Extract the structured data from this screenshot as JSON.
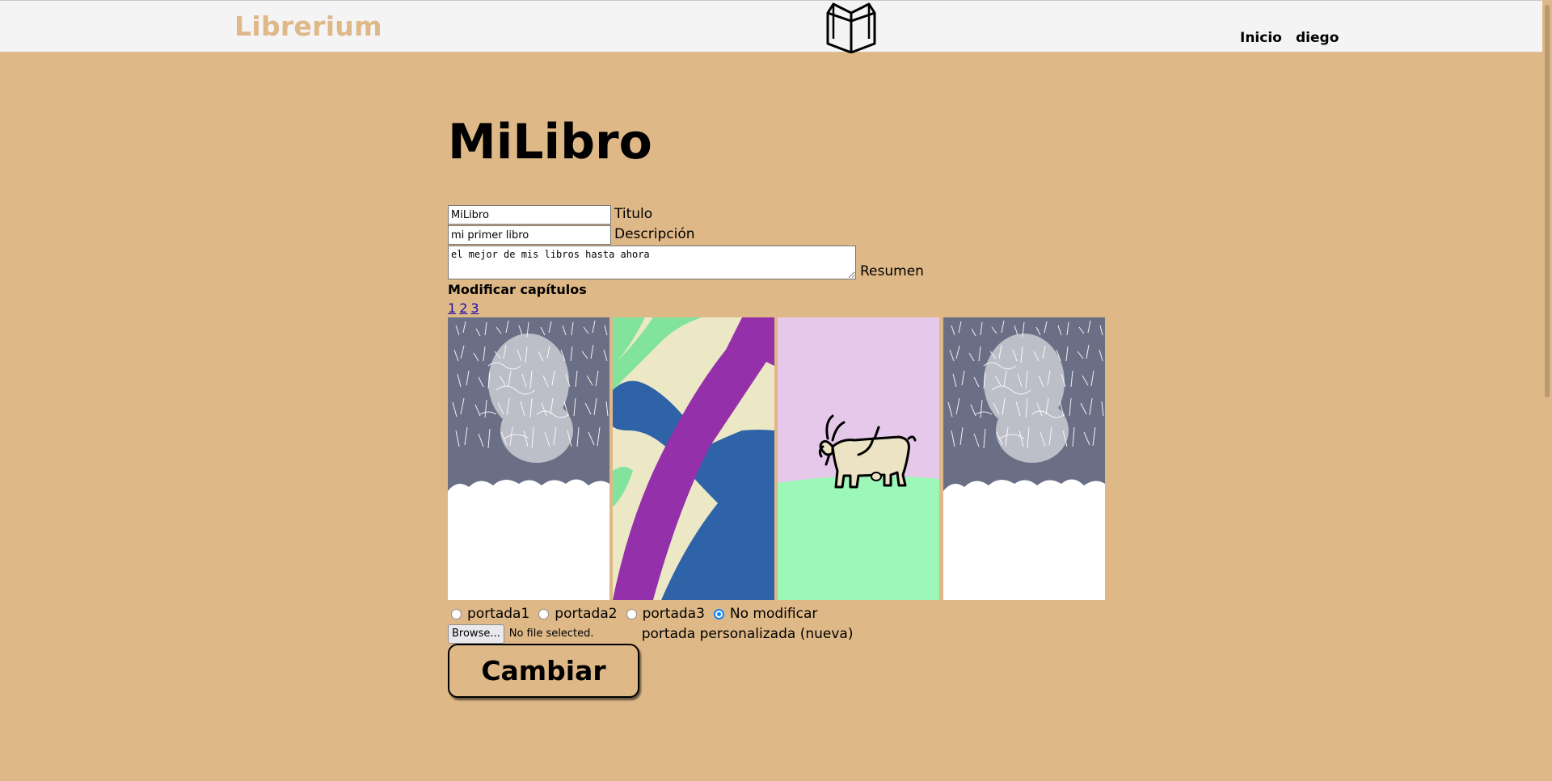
{
  "header": {
    "brand": "Librerium",
    "nav": [
      {
        "label": "Inicio"
      },
      {
        "label": "diego"
      }
    ]
  },
  "page": {
    "title": "MiLibro"
  },
  "form": {
    "title_value": "MiLibro",
    "title_label": "Titulo",
    "description_value": "mi primer libro",
    "description_label": "Descripción",
    "summary_value": "el mejor de mis libros hasta ahora",
    "summary_label": "Resumen",
    "chapters_title": "Modificar capítulos",
    "chapters": [
      "1",
      "2",
      "3"
    ],
    "covers": [
      {
        "icon": "snowy-forest-cover"
      },
      {
        "icon": "abstract-stripes-cover"
      },
      {
        "icon": "goat-cover"
      },
      {
        "icon": "snowy-forest-cover"
      }
    ],
    "cover_options": [
      {
        "label": "portada1",
        "checked": false
      },
      {
        "label": "portada2",
        "checked": false
      },
      {
        "label": "portada3",
        "checked": false
      },
      {
        "label": "No modificar",
        "checked": true
      }
    ],
    "browse_label": "Browse...",
    "file_status": "No file selected.",
    "custom_cover_label": "portada personalizada (nueva)",
    "submit_label": "Cambiar"
  },
  "colors": {
    "background": "#deb887",
    "header": "#f4f4f4",
    "brand": "#deb887",
    "link": "#1a0dab"
  }
}
